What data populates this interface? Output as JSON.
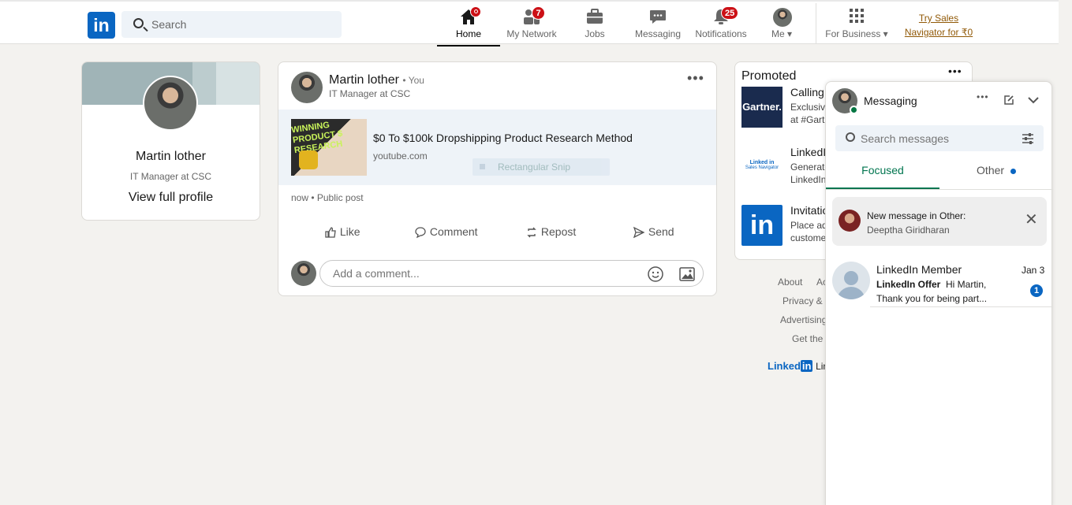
{
  "nav": {
    "logo": "in",
    "search_placeholder": "Search",
    "items": [
      {
        "label": "Home",
        "icon": "home-icon"
      },
      {
        "label": "My Network",
        "icon": "network-icon",
        "badge": "7"
      },
      {
        "label": "Jobs",
        "icon": "jobs-icon"
      },
      {
        "label": "Messaging",
        "icon": "messaging-icon"
      },
      {
        "label": "Notifications",
        "icon": "bell-icon",
        "badge": "25"
      },
      {
        "label": "Me",
        "icon": "avatar"
      }
    ],
    "for_business": "For Business",
    "try_sales_line1": "Try Sales",
    "try_sales_line2": "Navigator for ₹0"
  },
  "profile": {
    "name": "Martin lother",
    "headline": "IT Manager at CSC",
    "view_profile": "View full profile"
  },
  "post": {
    "author": "Martin lother",
    "you_tag": "• You",
    "headline": "IT Manager at CSC",
    "link_title": "$0 To $100k Dropshipping Product Research Method",
    "link_domain": "youtube.com",
    "overlay_text": "Rectangular Snip",
    "thumb_text_1": "WINNING",
    "thumb_text_2": "PRODUCT $",
    "thumb_text_3": "RESEARCH",
    "meta": "now • Public post",
    "actions": [
      "Like",
      "Comment",
      "Repost",
      "Send"
    ],
    "comment_placeholder": "Add a comment..."
  },
  "promoted": {
    "title": "Promoted",
    "items": [
      {
        "logo": "Gartner.",
        "title": "Calling",
        "line1": "Exclusiv",
        "line2": "at #Gart"
      },
      {
        "logo": "Linked in",
        "logo_sub": "Sales Navigator",
        "title": "LinkedI",
        "line1": "Generate",
        "line2": "LinkedIn"
      },
      {
        "logo": "in",
        "title": "Invitatio",
        "line1": "Place ad",
        "line2": "custome"
      }
    ]
  },
  "footer": {
    "links": [
      "About",
      "Ac",
      "Privacy &",
      "Advertising",
      "Get the"
    ],
    "brand": "Linked",
    "brand_in": "in",
    "brand_tail": "Lin"
  },
  "messaging": {
    "title": "Messaging",
    "search_placeholder": "Search messages",
    "tabs": [
      "Focused",
      "Other"
    ],
    "notice_title": "New message in Other:",
    "notice_name": "Deeptha Giridharan",
    "conversations": [
      {
        "name": "LinkedIn Member",
        "date": "Jan 3",
        "preview_bold": "LinkedIn Offer",
        "preview_1": "Hi Martin,",
        "preview_2": "Thank you for being part...",
        "unread": "1"
      }
    ]
  },
  "colors": {
    "brand_blue": "#0a66c2",
    "badge_red": "#cc1016",
    "focused_green": "#01754f",
    "try_sales": "#915907"
  }
}
